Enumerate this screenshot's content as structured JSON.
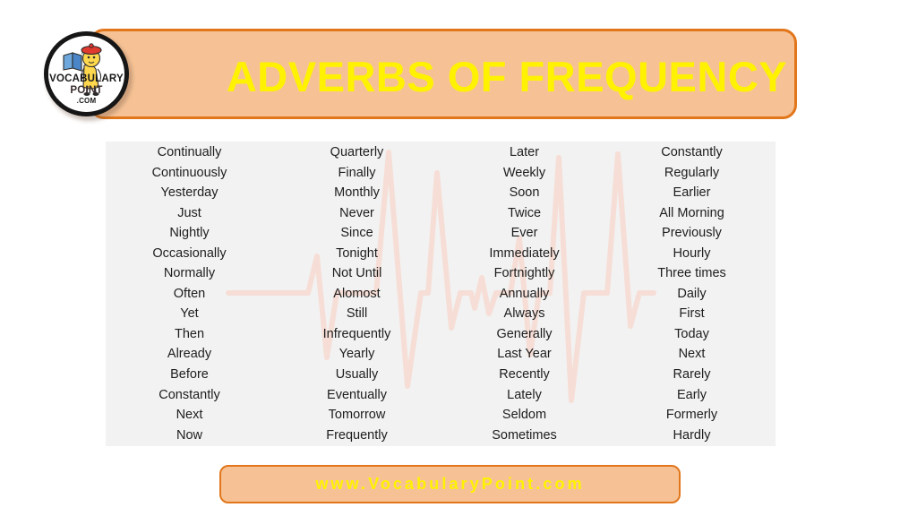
{
  "header": {
    "title": "ADVERBS OF FREQUENCY",
    "background_color": "#F6C295",
    "border_color": "#E2761B",
    "title_color": "#FFF200"
  },
  "logo": {
    "line1": "VOCABULARY",
    "line2": "POINT",
    "line3": ".COM",
    "mascot_name": "student-mascot-icon"
  },
  "panel": {
    "background_color": "#F2F2F2",
    "ekg_color": "#F6DED6",
    "columns": [
      {
        "name": "column-1",
        "words": [
          "Continually",
          "Continuously",
          "Yesterday",
          "Just",
          "Nightly",
          "Occasionally",
          "Normally",
          "Often",
          "Yet",
          "Then",
          "Already",
          "Before",
          "Constantly",
          "Next",
          "Now"
        ]
      },
      {
        "name": "column-2",
        "words": [
          "Quarterly",
          "Finally",
          "Monthly",
          "Never",
          "Since",
          "Tonight",
          "Not Until",
          "Alomost",
          "Still",
          "Infrequently",
          "Yearly",
          "Usually",
          "Eventually",
          "Tomorrow",
          "Frequently"
        ]
      },
      {
        "name": "column-3",
        "words": [
          "Later",
          "Weekly",
          "Soon",
          "Twice",
          "Ever",
          "Immediately",
          "Fortnightly",
          "Annually",
          "Always",
          "Generally",
          "Last Year",
          "Recently",
          "Lately",
          "Seldom",
          "Sometimes"
        ]
      },
      {
        "name": "column-4",
        "words": [
          "Constantly",
          "Regularly",
          "Earlier",
          "All Morning",
          "Previously",
          "Hourly",
          "Three times",
          "Daily",
          "First",
          "Today",
          "Next",
          "Rarely",
          "Early",
          "Formerly",
          "Hardly"
        ]
      }
    ]
  },
  "footer": {
    "text": "www.VocabularyPoint.com",
    "background_color": "#F6C295",
    "border_color": "#E2761B",
    "text_color": "#FFF200"
  }
}
